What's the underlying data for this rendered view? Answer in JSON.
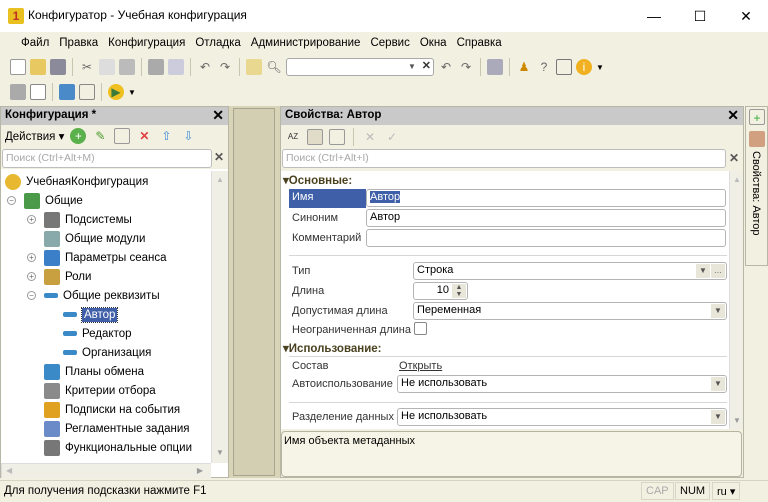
{
  "window": {
    "title": "Конфигуратор - Учебная конфигурация",
    "minimize": "—",
    "maximize": "☐",
    "close": "✕"
  },
  "menu": [
    "Файл",
    "Правка",
    "Конфигурация",
    "Отладка",
    "Администрирование",
    "Сервис",
    "Окна",
    "Справка"
  ],
  "left_panel": {
    "title": "Конфигурация *",
    "actions_label": "Действия",
    "search_placeholder": "Поиск (Ctrl+Alt+M)",
    "tree": [
      {
        "label": "УчебнаяКонфигурация",
        "level": 0,
        "icon": "config-icon",
        "color": "#e8b830"
      },
      {
        "label": "Общие",
        "level": 1,
        "expander": "−",
        "icon": "common-icon",
        "color": "#4a9a4a"
      },
      {
        "label": "Подсистемы",
        "level": 2,
        "expander": "+",
        "icon": "subsystems-icon",
        "color": "#777"
      },
      {
        "label": "Общие модули",
        "level": 2,
        "icon": "module-icon",
        "color": "#8aa"
      },
      {
        "label": "Параметры сеанса",
        "level": 2,
        "expander": "+",
        "icon": "session-params-icon",
        "color": "#3a7fc8"
      },
      {
        "label": "Роли",
        "level": 2,
        "expander": "+",
        "icon": "roles-icon",
        "color": "#c8a040"
      },
      {
        "label": "Общие реквизиты",
        "level": 2,
        "expander": "−",
        "icon": "attribute-icon",
        "color": "#3a8ac8"
      },
      {
        "label": "Автор",
        "level": 3,
        "icon": "attribute-icon",
        "color": "#3a8ac8",
        "selected": true
      },
      {
        "label": "Редактор",
        "level": 3,
        "icon": "attribute-icon",
        "color": "#3a8ac8"
      },
      {
        "label": "Организация",
        "level": 3,
        "icon": "attribute-icon",
        "color": "#3a8ac8"
      },
      {
        "label": "Планы обмена",
        "level": 2,
        "icon": "exchange-plans-icon",
        "color": "#3a8ac8"
      },
      {
        "label": "Критерии отбора",
        "level": 2,
        "icon": "filter-criteria-icon",
        "color": "#8a8a8a"
      },
      {
        "label": "Подписки на события",
        "level": 2,
        "icon": "event-subscriptions-icon",
        "color": "#e0a020"
      },
      {
        "label": "Регламентные задания",
        "level": 2,
        "icon": "scheduled-jobs-icon",
        "color": "#6a8ac8"
      },
      {
        "label": "Функциональные опции",
        "level": 2,
        "icon": "functional-options-icon",
        "color": "#777"
      }
    ]
  },
  "right_panel": {
    "title": "Свойства: Автор",
    "search_placeholder": "Поиск (Ctrl+Alt+I)",
    "groups": {
      "main": "Основные:",
      "usage": "Использование:"
    },
    "props": {
      "name": {
        "label": "Имя",
        "value": "Автор"
      },
      "synonym": {
        "label": "Синоним",
        "value": "Автор"
      },
      "comment": {
        "label": "Комментарий",
        "value": ""
      },
      "type": {
        "label": "Тип",
        "value": "Строка"
      },
      "length": {
        "label": "Длина",
        "value": "10"
      },
      "allowed_length": {
        "label": "Допустимая длина",
        "value": "Переменная"
      },
      "unlimited_length": {
        "label": "Неограниченная длина",
        "checked": false
      },
      "content": {
        "label": "Состав",
        "link": "Открыть"
      },
      "auto_use": {
        "label": "Автоиспользование",
        "value": "Не использовать"
      },
      "data_separation": {
        "label": "Разделение данных",
        "value": "Не использовать"
      }
    },
    "description": "Имя объекта метаданных"
  },
  "side_tab": {
    "label": "Свойства: Автор"
  },
  "status": {
    "hint": "Для получения подсказки нажмите F1",
    "cap": "CAP",
    "num": "NUM",
    "lang": "ru ▾"
  },
  "colors": {
    "selection": "#3f5fa8",
    "panel_header": "#c9c9c9",
    "background": "#f2f0e1"
  }
}
